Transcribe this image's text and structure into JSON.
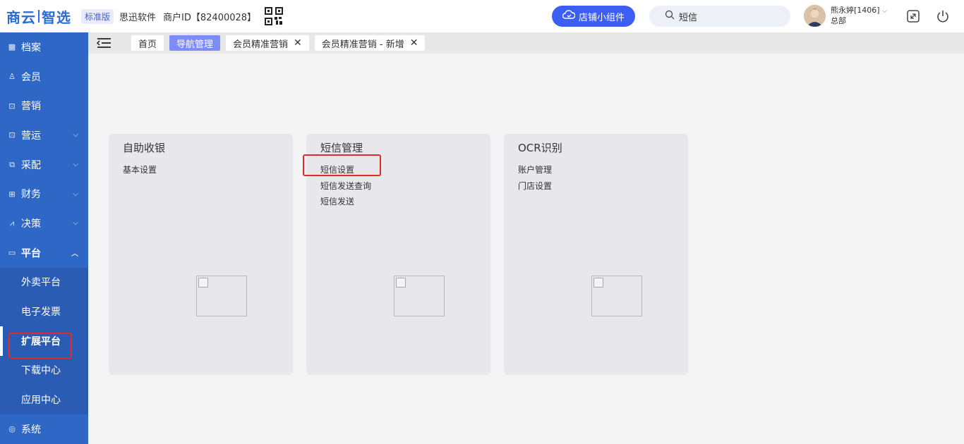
{
  "header": {
    "logo_left": "商云",
    "logo_right": "智选",
    "edition": "标准版",
    "company": "思迅软件",
    "merchant": "商户ID【82400028】",
    "widget_button": "店铺小组件",
    "search_value": "短信",
    "user_name": "熊永婷[1406]",
    "user_dept": "总部"
  },
  "sidebar": {
    "items": [
      {
        "label": "档案",
        "icon": "archive-icon"
      },
      {
        "label": "会员",
        "icon": "user-icon"
      },
      {
        "label": "营销",
        "icon": "gift-icon"
      },
      {
        "label": "营运",
        "icon": "shop-icon"
      },
      {
        "label": "采配",
        "icon": "box-icon"
      },
      {
        "label": "财务",
        "icon": "money-icon"
      },
      {
        "label": "决策",
        "icon": "chart-icon"
      },
      {
        "label": "平台",
        "icon": "monitor-icon"
      }
    ],
    "sub_items": [
      "外卖平台",
      "电子发票",
      "扩展平台",
      "下载中心",
      "应用中心"
    ],
    "system": "系统"
  },
  "tabs": [
    {
      "label": "首页"
    },
    {
      "label": "导航管理"
    },
    {
      "label": "会员精准营销"
    },
    {
      "label": "会员精准营销 - 新增"
    }
  ],
  "cards": [
    {
      "title": "自助收银",
      "links": [
        "基本设置"
      ]
    },
    {
      "title": "短信管理",
      "links": [
        "短信设置",
        "短信发送查询",
        "短信发送"
      ]
    },
    {
      "title": "OCR识别",
      "links": [
        "账户管理",
        "门店设置"
      ]
    }
  ],
  "colors": {
    "sidebar": "#2f67c6",
    "accent": "#3d5ef5",
    "active_tab": "#7c8ef5",
    "highlight": "#e02b2b"
  }
}
